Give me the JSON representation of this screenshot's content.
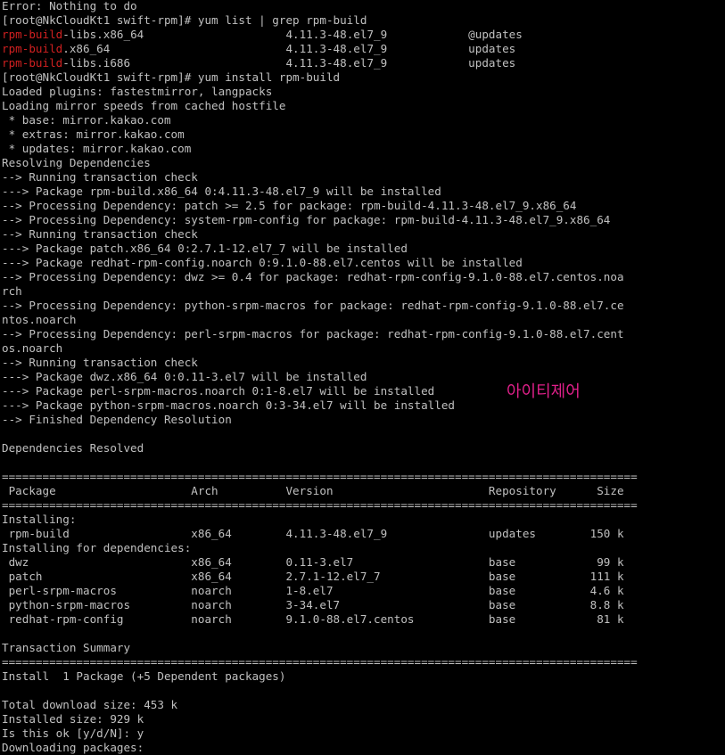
{
  "window": {
    "title": "",
    "watermark": "아이티제어"
  },
  "colors": {
    "background": "#000000",
    "text": "#c0c0c0",
    "highlight": "#d02020",
    "watermark": "#e0208a"
  },
  "terminal": {
    "lines": [
      {
        "text": "Error: Nothing to do"
      },
      {
        "text": "[root@NkCloudKt1 swift-rpm]# yum list | grep rpm-build"
      },
      {
        "hl": "rpm-build",
        "text": "-libs.x86_64                     4.11.3-48.el7_9            @updates"
      },
      {
        "hl": "rpm-build",
        "text": ".x86_64                          4.11.3-48.el7_9            updates"
      },
      {
        "hl": "rpm-build",
        "text": "-libs.i686                       4.11.3-48.el7_9            updates"
      },
      {
        "text": "[root@NkCloudKt1 swift-rpm]# yum install rpm-build"
      },
      {
        "text": "Loaded plugins: fastestmirror, langpacks"
      },
      {
        "text": "Loading mirror speeds from cached hostfile"
      },
      {
        "text": " * base: mirror.kakao.com"
      },
      {
        "text": " * extras: mirror.kakao.com"
      },
      {
        "text": " * updates: mirror.kakao.com"
      },
      {
        "text": "Resolving Dependencies"
      },
      {
        "text": "--> Running transaction check"
      },
      {
        "text": "---> Package rpm-build.x86_64 0:4.11.3-48.el7_9 will be installed"
      },
      {
        "text": "--> Processing Dependency: patch >= 2.5 for package: rpm-build-4.11.3-48.el7_9.x86_64"
      },
      {
        "text": "--> Processing Dependency: system-rpm-config for package: rpm-build-4.11.3-48.el7_9.x86_64"
      },
      {
        "text": "--> Running transaction check"
      },
      {
        "text": "---> Package patch.x86_64 0:2.7.1-12.el7_7 will be installed"
      },
      {
        "text": "---> Package redhat-rpm-config.noarch 0:9.1.0-88.el7.centos will be installed"
      },
      {
        "text": "--> Processing Dependency: dwz >= 0.4 for package: redhat-rpm-config-9.1.0-88.el7.centos.noa"
      },
      {
        "text": "rch"
      },
      {
        "text": "--> Processing Dependency: python-srpm-macros for package: redhat-rpm-config-9.1.0-88.el7.ce"
      },
      {
        "text": "ntos.noarch"
      },
      {
        "text": "--> Processing Dependency: perl-srpm-macros for package: redhat-rpm-config-9.1.0-88.el7.cent"
      },
      {
        "text": "os.noarch"
      },
      {
        "text": "--> Running transaction check"
      },
      {
        "text": "---> Package dwz.x86_64 0:0.11-3.el7 will be installed"
      },
      {
        "text": "---> Package perl-srpm-macros.noarch 0:1-8.el7 will be installed"
      },
      {
        "text": "---> Package python-srpm-macros.noarch 0:3-34.el7 will be installed"
      },
      {
        "text": "--> Finished Dependency Resolution"
      },
      {
        "text": ""
      },
      {
        "text": "Dependencies Resolved"
      },
      {
        "text": ""
      },
      {
        "text": "=============================================================================================="
      },
      {
        "text": " Package                    Arch          Version                       Repository      Size"
      },
      {
        "text": "=============================================================================================="
      },
      {
        "text": "Installing:"
      },
      {
        "text": " rpm-build                  x86_64        4.11.3-48.el7_9               updates        150 k"
      },
      {
        "text": "Installing for dependencies:"
      },
      {
        "text": " dwz                        x86_64        0.11-3.el7                    base            99 k"
      },
      {
        "text": " patch                      x86_64        2.7.1-12.el7_7                base           111 k"
      },
      {
        "text": " perl-srpm-macros           noarch        1-8.el7                       base           4.6 k"
      },
      {
        "text": " python-srpm-macros         noarch        3-34.el7                      base           8.8 k"
      },
      {
        "text": " redhat-rpm-config          noarch        9.1.0-88.el7.centos           base            81 k"
      },
      {
        "text": ""
      },
      {
        "text": "Transaction Summary"
      },
      {
        "text": "=============================================================================================="
      },
      {
        "text": "Install  1 Package (+5 Dependent packages)"
      },
      {
        "text": ""
      },
      {
        "text": "Total download size: 453 k"
      },
      {
        "text": "Installed size: 929 k"
      },
      {
        "text": "Is this ok [y/d/N]: y"
      },
      {
        "text": "Downloading packages:"
      }
    ]
  }
}
